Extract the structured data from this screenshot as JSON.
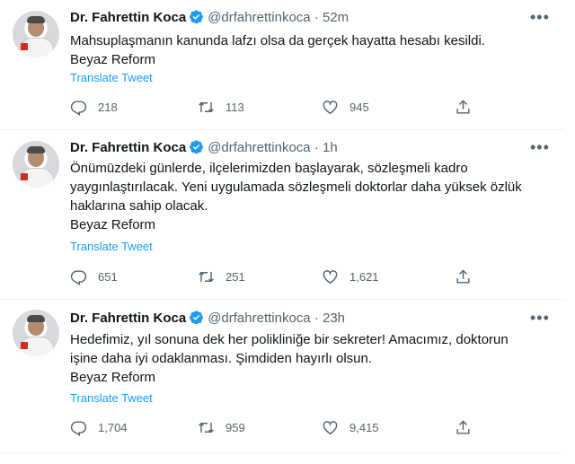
{
  "author": {
    "name": "Dr. Fahrettin Koca",
    "handle": "@drfahrettinkoca",
    "dot": "·"
  },
  "more_glyph": "•••",
  "tweets": [
    {
      "time": "52m",
      "lines": [
        "Mahsuplaşmanın kanunda lafzı olsa da gerçek hayatta hesabı kesildi.",
        "Beyaz Reform"
      ],
      "translate": "Translate Tweet",
      "replies": "218",
      "retweets": "113",
      "likes": "945"
    },
    {
      "time": "1h",
      "lines": [
        "Önümüzdeki günlerde, ilçelerimizden başlayarak, sözleşmeli kadro",
        "yaygınlaştırılacak. Yeni uygulamada sözleşmeli doktorlar daha yüksek özlük",
        "haklarına sahip olacak.",
        "Beyaz Reform"
      ],
      "translate": "Translate Tweet",
      "replies": "651",
      "retweets": "251",
      "likes": "1,621"
    },
    {
      "time": "23h",
      "lines": [
        "Hedefimiz, yıl sonuna dek her polikliniğe bir sekreter! Amacımız, doktorun",
        "işine daha iyi odaklanması. Şimdiden hayırlı olsun.",
        "Beyaz Reform"
      ],
      "translate": "Translate Tweet",
      "replies": "1,704",
      "retweets": "959",
      "likes": "9,415"
    }
  ],
  "icons": {
    "verified": "verified-badge-icon",
    "reply": "reply-icon",
    "retweet": "retweet-icon",
    "like": "heart-icon",
    "share": "share-icon",
    "more": "more-options-icon"
  },
  "colors": {
    "link": "#1d9bf0",
    "secondary": "#536471",
    "text": "#0f1419",
    "divider": "#eff3f4"
  }
}
